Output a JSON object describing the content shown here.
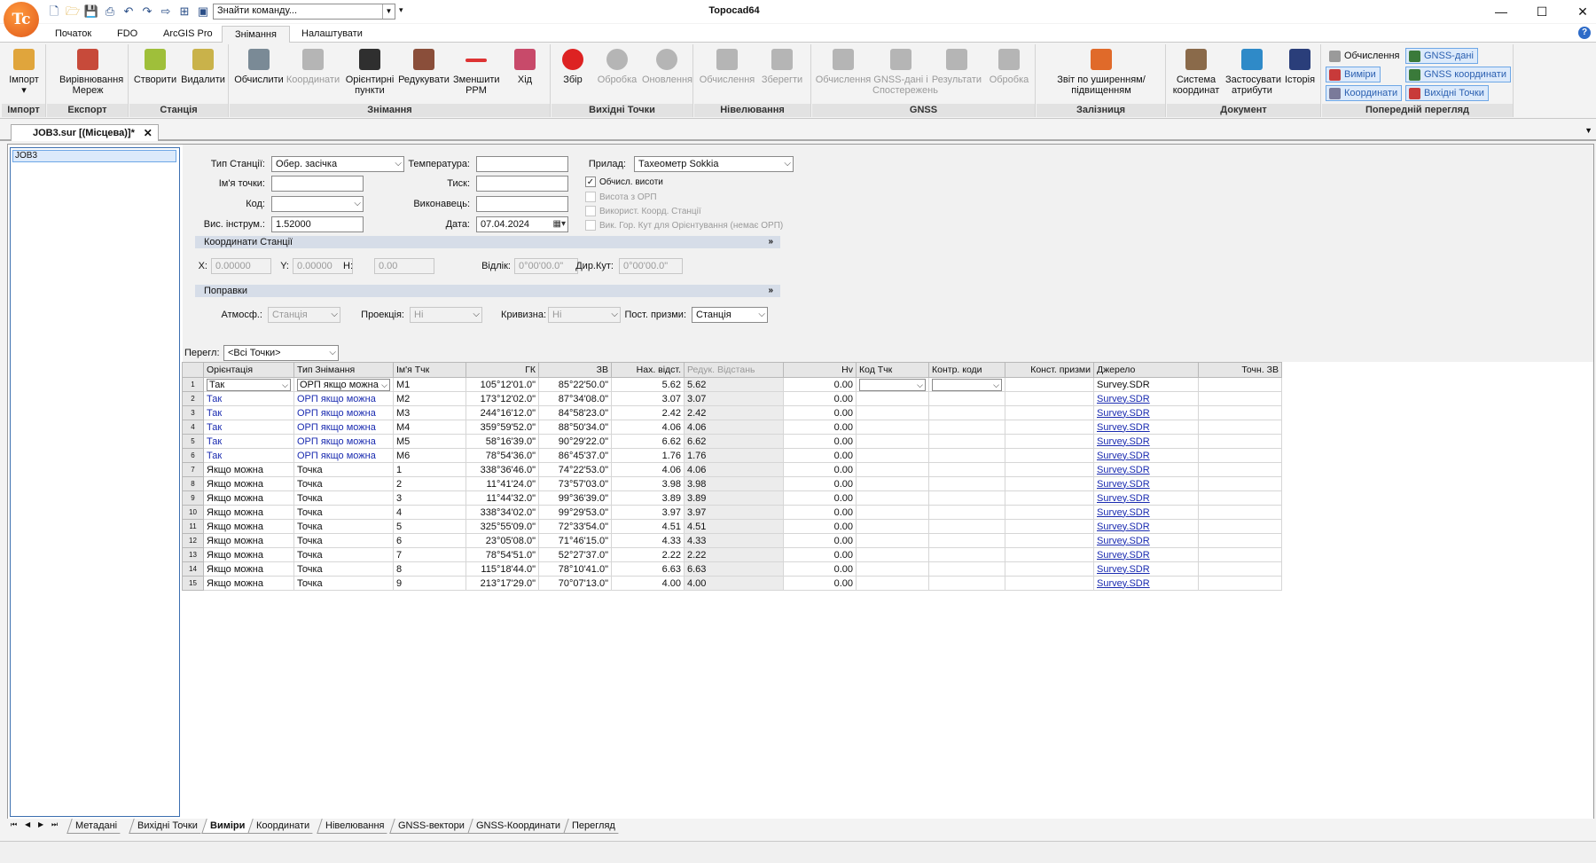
{
  "app": {
    "title": "Topocad64",
    "logo_text": "Tc"
  },
  "qat": {
    "search_value": "Знайти команду..."
  },
  "window": {
    "minimize": "—",
    "maximize": "☐",
    "close": "✕"
  },
  "ribbon_tabs": [
    "Початок",
    "FDO",
    "ArcGIS Pro",
    "Знімання",
    "Налаштувати"
  ],
  "ribbon": {
    "groups": [
      "Імпорт",
      "Експорт",
      "Станція",
      "Знімання",
      "Вихідні Точки",
      "Нівелювання",
      "GNSS",
      "Залізниця",
      "Документ",
      "Попередній перегляд"
    ],
    "buttons": {
      "import": "Імпорт",
      "import_arrow": "▾",
      "adjust_net": "Вирівнювання Мереж",
      "create": "Створити",
      "delete": "Видалити",
      "calculate": "Обчислити",
      "coordinates": "Координати",
      "orient_points": "Орієнтирні пункти",
      "edit": "Редукувати",
      "reduce_ppm": "Зменшити PPM",
      "traverse": "Хід",
      "collect": "Збір",
      "process": "Обробка",
      "update": "Оновлення",
      "level_calc": "Обчислення",
      "level_save": "Зберегти",
      "gnss_calc": "Обчислення",
      "gnss_data": "GNSS-дані і Спостережень",
      "gnss_results": "Результати",
      "gnss_process": "Обробка",
      "rail_report": "Звіт по уширенням/підвищенням",
      "coord_system": "Система координат",
      "apply_attrs": "Застосувати атрибути",
      "history": "Історія"
    },
    "preview": {
      "calc": "Обчислення",
      "gnss_data": "GNSS-дані",
      "measurements": "Виміри",
      "gnss_coords": "GNSS координати",
      "coordinates": "Координати",
      "control_points": "Вихідні Точки"
    }
  },
  "document_tab": {
    "label": "JOB3.sur [(Місцева)]*",
    "close": "✕"
  },
  "tree": {
    "root": "JOB3"
  },
  "form": {
    "station_type_label": "Тип Станції:",
    "station_type_value": "Обер. засічка",
    "point_name_label": "Ім'я точки:",
    "point_name_value": "",
    "code_label": "Код:",
    "code_value": "",
    "instr_height_label": "Вис. інструм.:",
    "instr_height_value": "1.52000",
    "temperature_label": "Температура:",
    "temperature_value": "",
    "pressure_label": "Тиск:",
    "pressure_value": "",
    "operator_label": "Виконавець:",
    "operator_value": "",
    "date_label": "Дата:",
    "date_value": "07.04.2024",
    "instrument_label": "Прилад:",
    "instrument_value": "Тахеометр Sokkia",
    "calc_heights": "Обчисл. висоти",
    "height_from_orp": "Висота з ОРП",
    "use_station_coords": "Використ. Коорд. Станції",
    "use_hz_angle": "Вик. Гор. Кут для Орієнтування (немає ОРП)"
  },
  "station_coords": {
    "title": "Координати Станції",
    "x_label": "X:",
    "x_value": "0.00000",
    "y_label": "Y:",
    "y_value": "0.00000",
    "h_label": "H:",
    "h_value": "0.00",
    "reading_label": "Відлік:",
    "reading_value": "0°00'00.0\"",
    "dir_angle_label": "Дир.Кут:",
    "dir_angle_value": "0°00'00.0\""
  },
  "corrections": {
    "title": "Поправки",
    "atmos_label": "Атмосф.:",
    "atmos_value": "Станція",
    "projection_label": "Проекція:",
    "projection_value": "Ні",
    "curvature_label": "Кривизна:",
    "curvature_value": "Ні",
    "prism_label": "Пост. призми:",
    "prism_value": "Станція"
  },
  "view": {
    "label": "Перегл:",
    "value": "<Всі Точки>"
  },
  "table": {
    "columns": [
      "Орієнтація",
      "Тип Знімання",
      "Ім'я Тчк",
      "ГК",
      "ЗВ",
      "Нах. відст.",
      "Редук. Відстань",
      "Hv",
      "Код Тчк",
      "Контр. коди",
      "Конст. призми",
      "Джерело",
      "Точн. ЗВ"
    ],
    "rows": [
      [
        "1",
        "Так",
        "ОРП якщо можна",
        "M1",
        "105°12'01.0\"",
        "85°22'50.0\"",
        "5.62",
        "5.62",
        "0.00",
        "",
        "",
        "",
        "Survey.SDR",
        ""
      ],
      [
        "2",
        "Так",
        "ОРП якщо можна",
        "M2",
        "173°12'02.0\"",
        "87°34'08.0\"",
        "3.07",
        "3.07",
        "0.00",
        "",
        "",
        "",
        "Survey.SDR",
        ""
      ],
      [
        "3",
        "Так",
        "ОРП якщо можна",
        "M3",
        "244°16'12.0\"",
        "84°58'23.0\"",
        "2.42",
        "2.42",
        "0.00",
        "",
        "",
        "",
        "Survey.SDR",
        ""
      ],
      [
        "4",
        "Так",
        "ОРП якщо можна",
        "M4",
        "359°59'52.0\"",
        "88°50'34.0\"",
        "4.06",
        "4.06",
        "0.00",
        "",
        "",
        "",
        "Survey.SDR",
        ""
      ],
      [
        "5",
        "Так",
        "ОРП якщо можна",
        "M5",
        "58°16'39.0\"",
        "90°29'22.0\"",
        "6.62",
        "6.62",
        "0.00",
        "",
        "",
        "",
        "Survey.SDR",
        ""
      ],
      [
        "6",
        "Так",
        "ОРП якщо можна",
        "M6",
        "78°54'36.0\"",
        "86°45'37.0\"",
        "1.76",
        "1.76",
        "0.00",
        "",
        "",
        "",
        "Survey.SDR",
        ""
      ],
      [
        "7",
        "Якщо можна",
        "Точка",
        "1",
        "338°36'46.0\"",
        "74°22'53.0\"",
        "4.06",
        "4.06",
        "0.00",
        "",
        "",
        "",
        "Survey.SDR",
        ""
      ],
      [
        "8",
        "Якщо можна",
        "Точка",
        "2",
        "11°41'24.0\"",
        "73°57'03.0\"",
        "3.98",
        "3.98",
        "0.00",
        "",
        "",
        "",
        "Survey.SDR",
        ""
      ],
      [
        "9",
        "Якщо можна",
        "Точка",
        "3",
        "11°44'32.0\"",
        "99°36'39.0\"",
        "3.89",
        "3.89",
        "0.00",
        "",
        "",
        "",
        "Survey.SDR",
        ""
      ],
      [
        "10",
        "Якщо можна",
        "Точка",
        "4",
        "338°34'02.0\"",
        "99°29'53.0\"",
        "3.97",
        "3.97",
        "0.00",
        "",
        "",
        "",
        "Survey.SDR",
        ""
      ],
      [
        "11",
        "Якщо можна",
        "Точка",
        "5",
        "325°55'09.0\"",
        "72°33'54.0\"",
        "4.51",
        "4.51",
        "0.00",
        "",
        "",
        "",
        "Survey.SDR",
        ""
      ],
      [
        "12",
        "Якщо можна",
        "Точка",
        "6",
        "23°05'08.0\"",
        "71°46'15.0\"",
        "4.33",
        "4.33",
        "0.00",
        "",
        "",
        "",
        "Survey.SDR",
        ""
      ],
      [
        "13",
        "Якщо можна",
        "Точка",
        "7",
        "78°54'51.0\"",
        "52°27'37.0\"",
        "2.22",
        "2.22",
        "0.00",
        "",
        "",
        "",
        "Survey.SDR",
        ""
      ],
      [
        "14",
        "Якщо можна",
        "Точка",
        "8",
        "115°18'44.0\"",
        "78°10'41.0\"",
        "6.63",
        "6.63",
        "0.00",
        "",
        "",
        "",
        "Survey.SDR",
        ""
      ],
      [
        "15",
        "Якщо можна",
        "Точка",
        "9",
        "213°17'29.0\"",
        "70°07'13.0\"",
        "4.00",
        "4.00",
        "0.00",
        "",
        "",
        "",
        "Survey.SDR",
        ""
      ]
    ]
  },
  "bottom_tabs": [
    "Метадані",
    "Вихідні Точки",
    "Виміри",
    "Координати",
    "Нівелювання",
    "GNSS-вектори",
    "GNSS-Координати",
    "Перегляд"
  ],
  "colors": {
    "accent": "#2d6bc8",
    "link": "#1a2bb0",
    "logo": "#e8661f"
  }
}
